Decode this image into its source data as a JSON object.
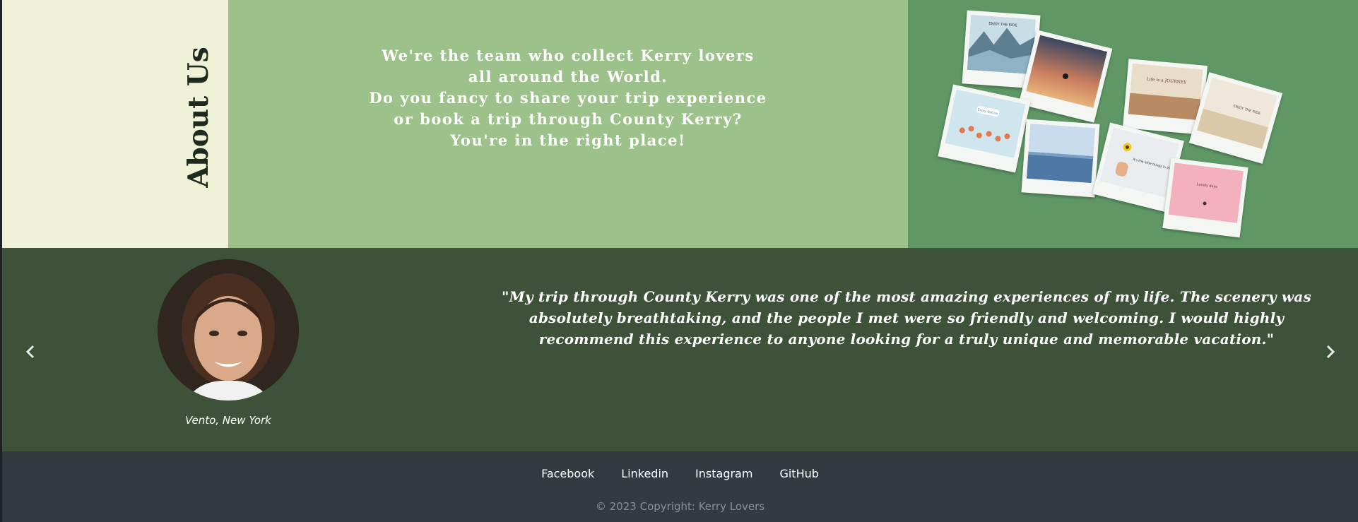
{
  "about": {
    "title": "About Us",
    "lines": [
      "We're the team who collect Kerry lovers",
      "all around the World.",
      "Do you fancy to share your trip experience",
      "or book a trip through County Kerry?",
      "You're in the right place!"
    ],
    "collage_caption_texts": [
      "ENJOY THE RIDE",
      "Life is a JOURNEY",
      "ENJOY THE RIDE",
      "Enjoy Nature",
      "It's the little things in life",
      "Lovely days"
    ]
  },
  "testimonial": {
    "quote": "\"My trip through County Kerry was one of the most amazing experiences of my life. The scenery was absolutely breathtaking, and the people I met were so friendly and welcoming. I would highly recommend this experience to anyone looking for a truly unique and memorable vacation.\"",
    "author": "Vento, New York",
    "prev_icon": "chevron-left-icon",
    "next_icon": "chevron-right-icon"
  },
  "footer": {
    "links": [
      "Facebook",
      "Linkedin",
      "Instagram",
      "GitHub"
    ],
    "copyright": "© 2023 Copyright: Kerry Lovers"
  },
  "colors": {
    "about_title_bg": "#eff2d7",
    "about_text_bg": "#9dc18b",
    "about_photo_bg": "#5f9865",
    "testimonial_bg": "#3e5139",
    "footer_bg": "#343a40"
  }
}
